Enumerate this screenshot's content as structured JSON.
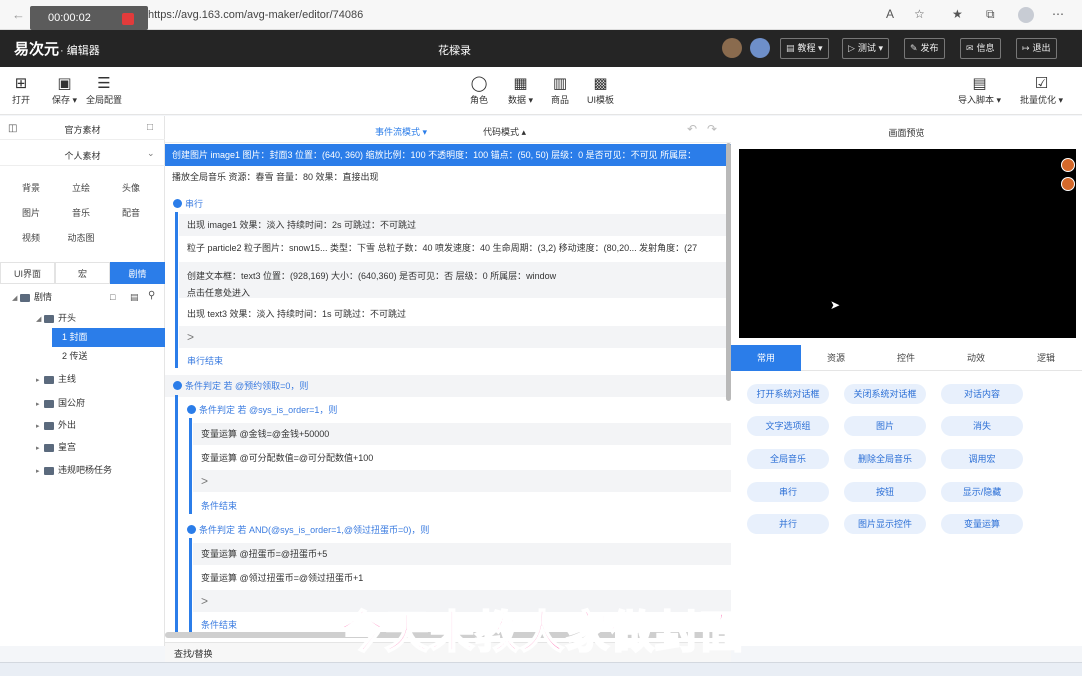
{
  "browser": {
    "recording_time": "00:00:02",
    "url": "https://avg.163.com/avg-maker/editor/74086"
  },
  "header": {
    "logo": "易次元",
    "logo_suffix": "· 编辑器",
    "doc_title": "花樑录",
    "buttons": {
      "tutorial": "教程",
      "test": "测试",
      "publish": "发布",
      "info": "信息",
      "exit": "退出"
    }
  },
  "toolbar": {
    "open": "打开",
    "save": "保存",
    "global_config": "全局配置",
    "character": "角色",
    "data": "数据",
    "goods": "商品",
    "ui_template": "UI模板",
    "import_script": "导入脚本",
    "batch_optimize": "批量优化"
  },
  "left": {
    "official_assets": "官方素材",
    "personal_assets": "个人素材",
    "asset_types": [
      "背景",
      "立绘",
      "头像",
      "图片",
      "音乐",
      "配音",
      "视频",
      "动态图"
    ],
    "tabs": [
      "UI界面",
      "宏",
      "剧情"
    ],
    "tree": {
      "root": "剧情",
      "chapter": "开头",
      "children": [
        "1 封面",
        "2 传送"
      ],
      "folders": [
        "主线",
        "国公府",
        "外出",
        "皇宫",
        "违规吧杨任务"
      ]
    }
  },
  "center": {
    "mode_event": "事件流模式",
    "mode_code": "代码模式",
    "lines": [
      "创建图片 image1 图片：封面3 位置：(640, 360) 缩放比例：100 不透明度：100 锚点：(50, 50) 层级：0 是否可见：不可见 所属层：",
      "播放全局音乐 资源：春雪 音量：80 效果：直接出现",
      "串行",
      "出现 image1 效果：淡入 持续时间：2s 可跳过：不可跳过",
      "粒子 particle2 粒子图片：snow15... 类型：下雪 总粒子数：40 喷发速度：40 生命周期：(3,2) 移动速度：(80,20... 发射角度：(27",
      "创建文本框：text3 位置：(928,169) 大小：(640,360) 是否可见：否 层级：0 所属层：window",
      "点击任意处进入",
      "出现 text3 效果：淡入 持续时间：1s 可跳过：不可跳过",
      "串行结束",
      "条件判定 若 @预约领取=0，则",
      "条件判定 若 @sys_is_order=1，则",
      "变量运算 @金钱=@金钱+50000",
      "变量运算 @可分配数值=@可分配数值+100",
      "条件结束",
      "条件判定 若 AND(@sys_is_order=1,@领过扭蛋币=0)，则",
      "变量运算 @扭蛋币=@扭蛋币+5",
      "变量运算 @领过扭蛋币=@领过扭蛋币+1",
      "条件结束"
    ],
    "find_replace": "查找/替换",
    "caret": ">"
  },
  "right": {
    "preview_title": "画面预览",
    "tabs": [
      "常用",
      "资源",
      "控件",
      "动效",
      "逻辑"
    ],
    "commands": [
      "打开系统对话框",
      "关闭系统对话框",
      "对话内容",
      "文字选项组",
      "图片",
      "消失",
      "全局音乐",
      "删除全局音乐",
      "调用宏",
      "串行",
      "按钮",
      "显示/隐藏",
      "并行",
      "图片显示控件",
      "变量运算"
    ]
  },
  "caption": "今天来教大家做封面",
  "colors": {
    "accent": "#2b7de9",
    "header_bg": "#252525",
    "caption": "#ff4fa0"
  }
}
